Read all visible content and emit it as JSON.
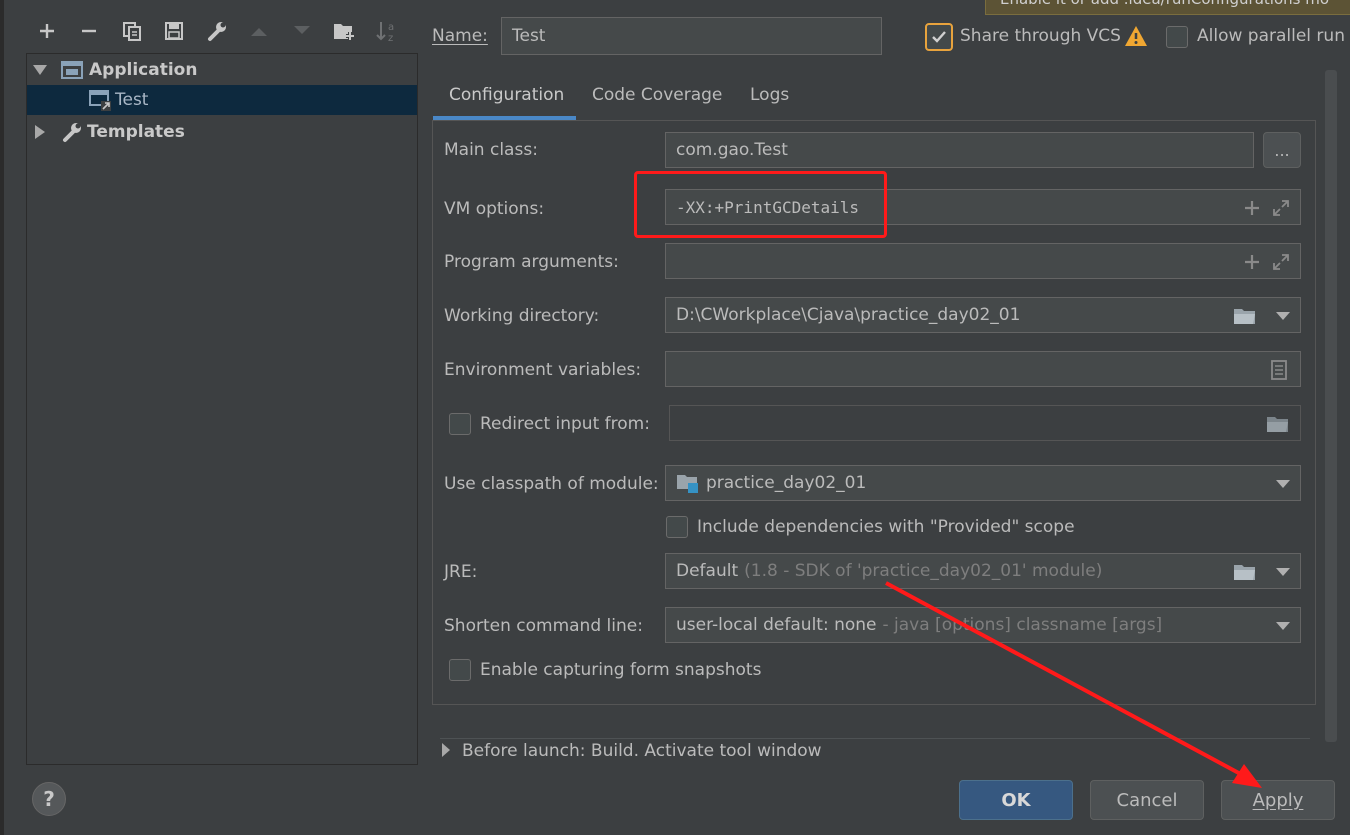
{
  "toolbar": {
    "icons": [
      "plus-icon",
      "minus-icon",
      "copy-icon",
      "save-icon",
      "wrench-icon",
      "arrow-up-icon",
      "arrow-down-icon",
      "new-folder-icon",
      "sort-icon"
    ]
  },
  "tree": {
    "application_label": "Application",
    "test_label": "Test",
    "templates_label": "Templates"
  },
  "header": {
    "name_label": "Name:",
    "name_value": "Test",
    "share_vcs_label": "Share through VCS",
    "allow_parallel_label": "Allow parallel run",
    "tooltip_text": "Enable it or add .idea/runConfigurations mo"
  },
  "tabs": [
    "Configuration",
    "Code Coverage",
    "Logs"
  ],
  "form": {
    "main_class_label": "Main class:",
    "main_class_value": "com.gao.Test",
    "browse_label": "...",
    "vm_options_label": "VM options:",
    "vm_options_value": "-XX:+PrintGCDetails",
    "program_args_label": "Program arguments:",
    "working_dir_label": "Working directory:",
    "working_dir_value": "D:\\CWorkplace\\Cjava\\practice_day02_01",
    "env_vars_label": "Environment variables:",
    "redirect_label": "Redirect input from:",
    "classpath_label": "Use classpath of module:",
    "classpath_value": "practice_day02_01",
    "include_deps_label": "Include dependencies with \"Provided\" scope",
    "jre_label": "JRE:",
    "jre_value": "Default",
    "jre_hint": "(1.8 - SDK of 'practice_day02_01' module)",
    "shorten_label": "Shorten command line:",
    "shorten_value": "user-local default: none",
    "shorten_hint": "- java [options] classname [args]",
    "capture_label": "Enable capturing form snapshots"
  },
  "before_launch": "Before launch: Build. Activate tool window",
  "buttons": {
    "help": "?",
    "ok": "OK",
    "cancel": "Cancel",
    "apply": "Apply"
  },
  "colors": {
    "background": "#3c3f41",
    "selection": "#0d293e",
    "tab_underline": "#4a88c7",
    "annotation_red": "#ff1a1a",
    "ok_button": "#365880",
    "vcs_checkbox_border": "#e8a33d"
  }
}
